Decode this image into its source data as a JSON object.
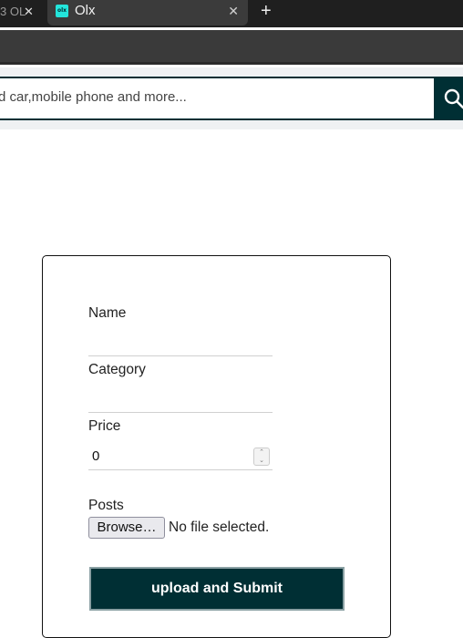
{
  "browser": {
    "prev_tab_title": "3 OL",
    "prev_tab_close": "✕",
    "active_tab_title": "Olx",
    "active_tab_favicon": "olx",
    "active_tab_close": "✕",
    "new_tab_label": "+"
  },
  "header": {
    "search_placeholder": "d car,mobile phone and more...",
    "search_icon": "search-icon"
  },
  "form": {
    "name_label": "Name",
    "name_value": "",
    "category_label": "Category",
    "category_value": "",
    "price_label": "Price",
    "price_value": "0",
    "posts_label": "Posts",
    "browse_label": "Browse…",
    "file_status": "No file selected.",
    "submit_label": "upload and Submit"
  },
  "colors": {
    "brand_dark": "#002f34",
    "header_bg": "#eff1f3"
  }
}
